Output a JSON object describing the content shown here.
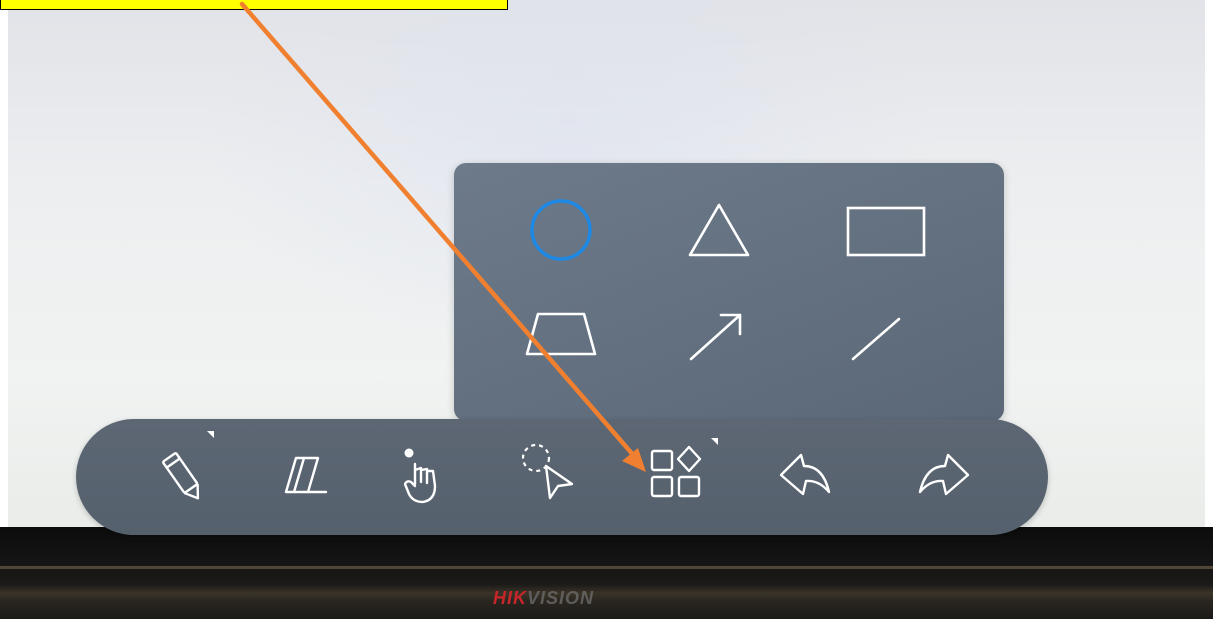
{
  "caption": {
    "text": "",
    "background": "#ffff00"
  },
  "shapes_panel": {
    "items": [
      {
        "id": "circle",
        "icon": "circle-icon",
        "selected": true
      },
      {
        "id": "triangle",
        "icon": "triangle-icon",
        "selected": false
      },
      {
        "id": "rectangle",
        "icon": "rectangle-icon",
        "selected": false
      },
      {
        "id": "trapezoid",
        "icon": "trapezoid-icon",
        "selected": false
      },
      {
        "id": "arrow",
        "icon": "arrow-icon",
        "selected": false
      },
      {
        "id": "line",
        "icon": "line-icon",
        "selected": false
      }
    ],
    "selected_color": "#1e88e5"
  },
  "toolbar": {
    "tools": [
      {
        "id": "pen",
        "icon": "pen-icon",
        "has_submenu": true
      },
      {
        "id": "eraser",
        "icon": "eraser-icon",
        "has_submenu": false
      },
      {
        "id": "hand",
        "icon": "hand-pointer-icon",
        "has_submenu": false
      },
      {
        "id": "lasso-select",
        "icon": "lasso-select-icon",
        "has_submenu": false
      },
      {
        "id": "shapes",
        "icon": "shapes-icon",
        "has_submenu": true
      },
      {
        "id": "undo",
        "icon": "undo-icon",
        "has_submenu": false
      },
      {
        "id": "redo",
        "icon": "redo-icon",
        "has_submenu": false
      }
    ]
  },
  "annotation": {
    "arrow_color": "#f08030"
  },
  "brand": {
    "part1": "HIK",
    "part2": "VISION"
  }
}
